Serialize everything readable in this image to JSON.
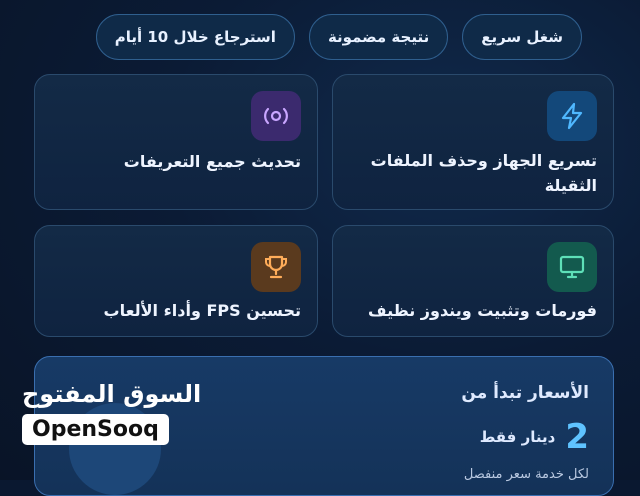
{
  "features": [
    "شغل سريع",
    "نتيجة مضمونة",
    "استرجاع خلال 10 أيام"
  ],
  "cards": [
    {
      "title": "تسريع الجهاز وحذف الملفات الثقيلة",
      "icon": "lightning-icon"
    },
    {
      "title": "تحديث جميع التعريفات",
      "icon": "radio-signal-icon"
    },
    {
      "title": "فورمات وتثبيت ويندوز نظيف",
      "icon": "monitor-icon"
    },
    {
      "title": "تحسين FPS وأداء الألعاب",
      "icon": "trophy-icon"
    }
  ],
  "pricing": {
    "heading": "الأسعار تبدأ من",
    "amount": "2",
    "unit": "دينار فقط",
    "note": "لكل خدمة سعر منفصل"
  },
  "watermark": {
    "arabic": "السوق المفتوح",
    "latin": "OpenSooq"
  },
  "colors": {
    "background": "#0a1830",
    "accent": "#5fc3ff"
  }
}
